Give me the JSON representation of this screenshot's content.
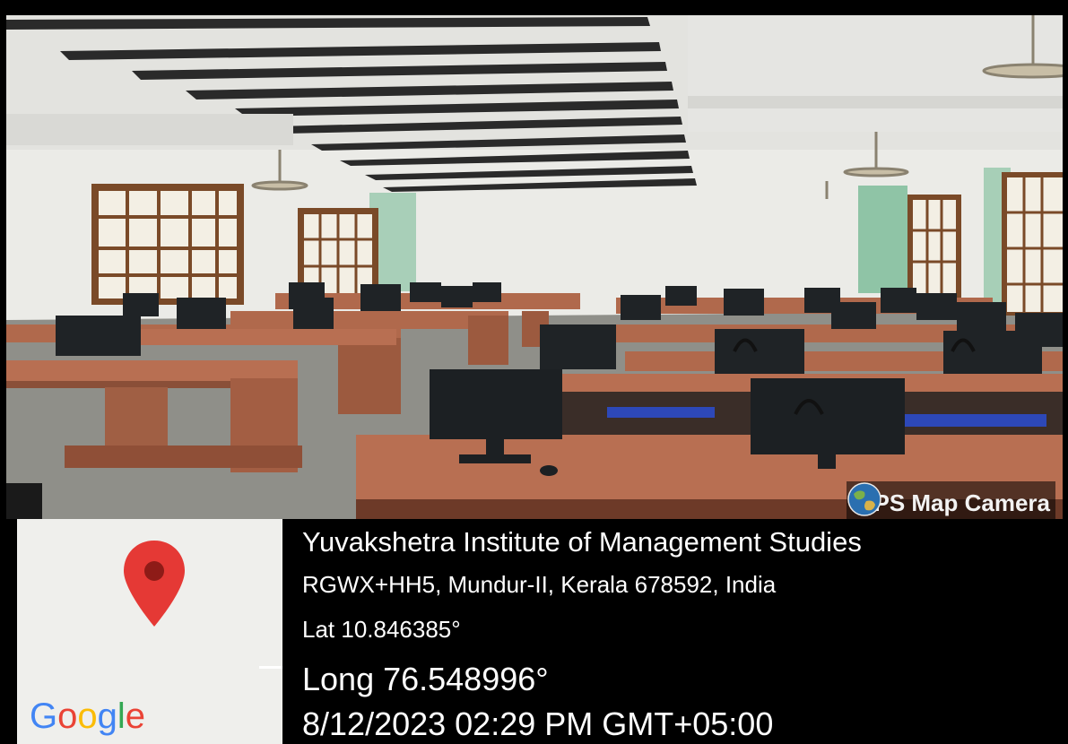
{
  "photo": {
    "description_icon": "photo-of-computer-lab",
    "colors": {
      "ceiling": "#e6e6e2",
      "wall": "#e8e8e4",
      "floor": "#8e8e88",
      "desk": "#b86f52",
      "monitor": "#1f2326",
      "chair": "#2d48b8",
      "window_frame": "#7a4a28"
    }
  },
  "watermark": {
    "label": "GPS Map Camera",
    "icon": "globe-icon"
  },
  "map": {
    "brand": "Google",
    "pin_icon": "map-pin-icon",
    "pin_color": "#e53935"
  },
  "location": {
    "name": "Yuvakshetra Institute of  Management Studies",
    "address": "RGWX+HH5, Mundur-II, Kerala 678592, India",
    "lat": "Lat 10.846385°",
    "long": "Long 76.548996°",
    "datetime": "8/12/2023 02:29 PM GMT+05:00"
  }
}
